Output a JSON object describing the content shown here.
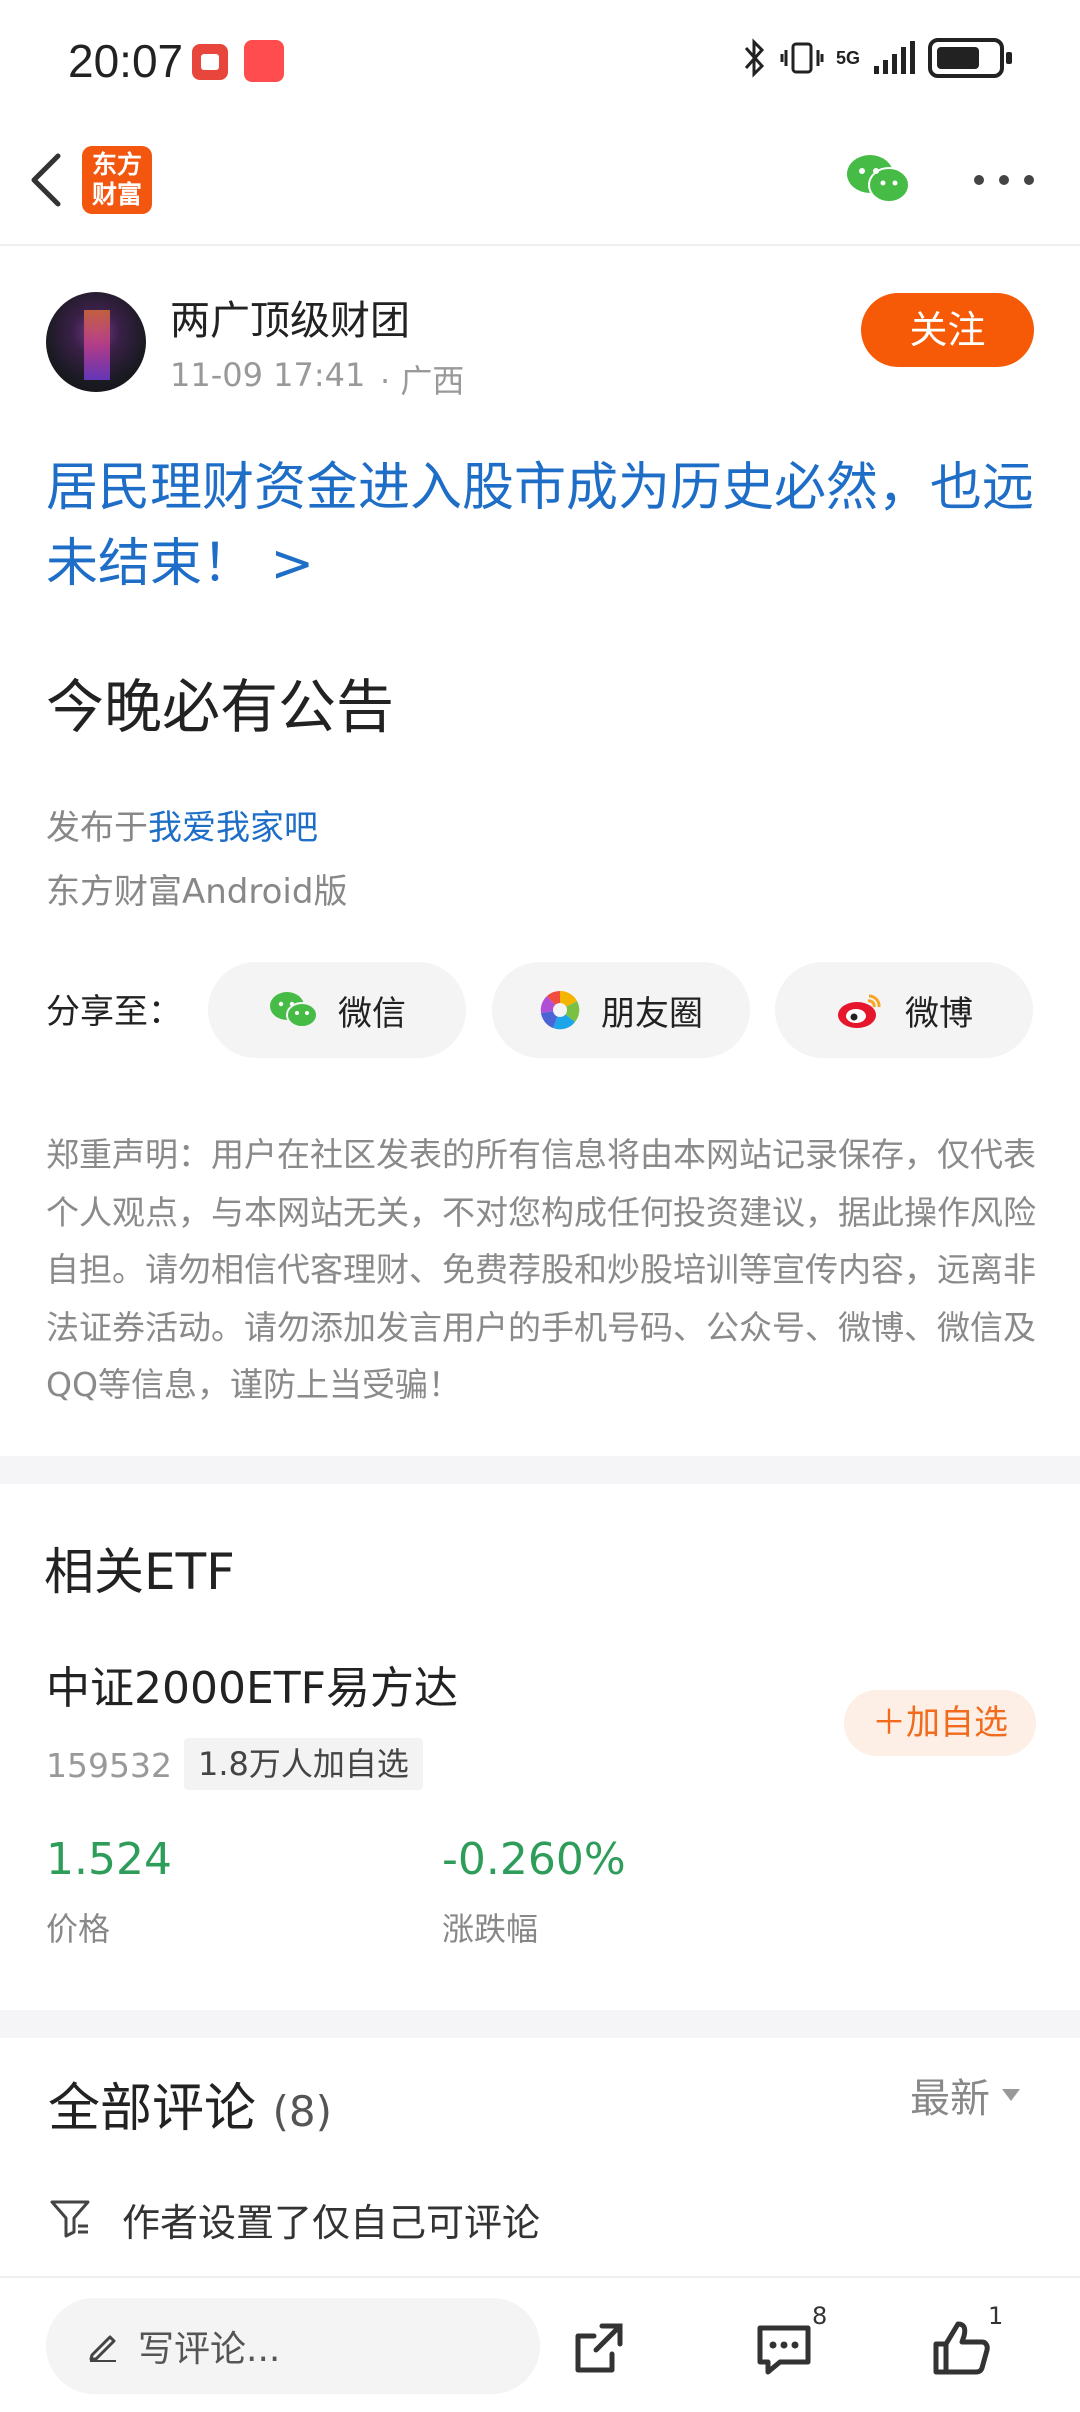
{
  "status_bar": {
    "time": "20:07",
    "network": "5G"
  },
  "nav": {
    "logo_text_line1": "东方",
    "logo_text_line2": "财富"
  },
  "author": {
    "name": "两广顶级财团",
    "time": "11-09 17:41",
    "location": "· 广西",
    "follow_label": "关注"
  },
  "post": {
    "headline": "居民理财资金进入股市成为历史必然，也远未结束！ >",
    "title": "今晚必有公告",
    "published_prefix": "发布于",
    "published_link": "我爱我家吧",
    "client": "东方财富Android版"
  },
  "share": {
    "label": "分享至：",
    "wechat": "微信",
    "moments": "朋友圈",
    "weibo": "微博"
  },
  "disclaimer": "郑重声明：用户在社区发表的所有信息将由本网站记录保存，仅代表个人观点，与本网站无关，不对您构成任何投资建议，据此操作风险自担。请勿相信代客理财、免费荐股和炒股培训等宣传内容，远离非法证券活动。请勿添加发言用户的手机号码、公众号、微博、微信及QQ等信息，谨防上当受骗！",
  "etf": {
    "heading": "相关ETF",
    "name": "中证2000ETF易方达",
    "code": "159532",
    "followers": "1.8万人加自选",
    "add_label": "＋加自选",
    "price": "1.524",
    "price_label": "价格",
    "change": "-0.260%",
    "change_label": "涨跌幅",
    "change_color": "#2e9d5a"
  },
  "comments": {
    "heading": "全部评论",
    "count": "(8)",
    "sort_label": "最新",
    "note": "作者设置了仅自己可评论"
  },
  "bottom_bar": {
    "input_placeholder": "写评论...",
    "comment_count": "8",
    "like_count": "1"
  },
  "colors": {
    "accent": "#f65a06",
    "link": "#1e6ec8"
  }
}
